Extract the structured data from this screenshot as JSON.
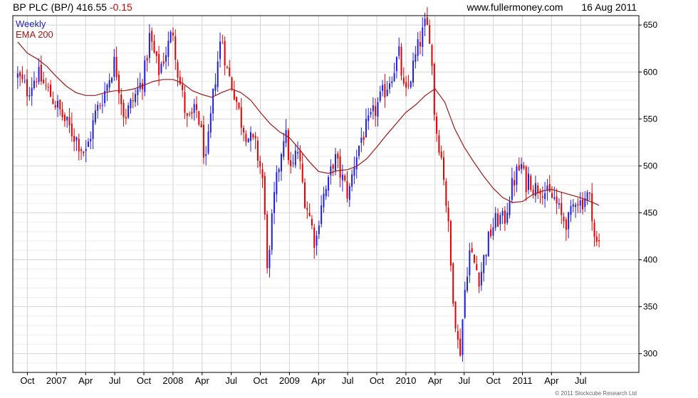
{
  "header": {
    "name": "BP PLC",
    "symbol": "(BP/)",
    "price": "416.55",
    "change": "-0.15",
    "site": "www.fullermoney.com",
    "date": "16 Aug 2011"
  },
  "footer": {
    "copyright": "© 2011 Stockcube Research Ltd"
  },
  "chart_data": {
    "type": "candlestick",
    "title": "BP PLC (BP/) 416.55 -0.15",
    "legend": [
      {
        "label": "Weekly",
        "color": "#1f1fbf"
      },
      {
        "label": "EMA 200",
        "color": "#a01818"
      }
    ],
    "legend_position": "top-left",
    "colors": {
      "up": "#1f1fe0",
      "down": "#e00000",
      "ema": "#a01818",
      "grid": "#d4d4d4"
    },
    "grid": true,
    "yaxis_side": "right",
    "ylim": [
      280,
      660
    ],
    "yticks": [
      300,
      350,
      400,
      450,
      500,
      550,
      600,
      650
    ],
    "xlim": [
      -1.5,
      63
    ],
    "xticks": [
      {
        "label": "Oct",
        "x": 0
      },
      {
        "label": "2007",
        "x": 3
      },
      {
        "label": "Apr",
        "x": 6
      },
      {
        "label": "Jul",
        "x": 9
      },
      {
        "label": "Oct",
        "x": 12
      },
      {
        "label": "2008",
        "x": 15
      },
      {
        "label": "Apr",
        "x": 18
      },
      {
        "label": "Jul",
        "x": 21
      },
      {
        "label": "Oct",
        "x": 24
      },
      {
        "label": "2009",
        "x": 27
      },
      {
        "label": "Apr",
        "x": 30
      },
      {
        "label": "Jul",
        "x": 33
      },
      {
        "label": "Oct",
        "x": 36
      },
      {
        "label": "2010",
        "x": 39
      },
      {
        "label": "Apr",
        "x": 42
      },
      {
        "label": "Jul",
        "x": 45
      },
      {
        "label": "Oct",
        "x": 48
      },
      {
        "label": "2011",
        "x": 51
      },
      {
        "label": "Apr",
        "x": 54
      },
      {
        "label": "Jul",
        "x": 57
      }
    ],
    "price_path": [
      [
        -1.0,
        595
      ],
      [
        0.0,
        580
      ],
      [
        1.0,
        598
      ],
      [
        2.0,
        582
      ],
      [
        3.0,
        565
      ],
      [
        4.0,
        545
      ],
      [
        5.0,
        530
      ],
      [
        6.0,
        512
      ],
      [
        7.0,
        555
      ],
      [
        8.0,
        580
      ],
      [
        9.0,
        612
      ],
      [
        10.0,
        552
      ],
      [
        11.0,
        572
      ],
      [
        12.0,
        595
      ],
      [
        12.6,
        638
      ],
      [
        13.5,
        600
      ],
      [
        14.5,
        628
      ],
      [
        15.0,
        645
      ],
      [
        15.5,
        600
      ],
      [
        16.5,
        545
      ],
      [
        17.5,
        560
      ],
      [
        18.4,
        502
      ],
      [
        19.3,
        590
      ],
      [
        20.0,
        640
      ],
      [
        20.6,
        600
      ],
      [
        21.3,
        580
      ],
      [
        22.0,
        548
      ],
      [
        22.8,
        530
      ],
      [
        23.5,
        520
      ],
      [
        24.2,
        490
      ],
      [
        24.8,
        382
      ],
      [
        25.3,
        455
      ],
      [
        25.9,
        500
      ],
      [
        26.5,
        540
      ],
      [
        27.2,
        490
      ],
      [
        27.8,
        520
      ],
      [
        28.5,
        470
      ],
      [
        29.2,
        440
      ],
      [
        29.7,
        415
      ],
      [
        30.2,
        460
      ],
      [
        31.0,
        480
      ],
      [
        31.6,
        510
      ],
      [
        32.3,
        490
      ],
      [
        33.1,
        468
      ],
      [
        33.7,
        505
      ],
      [
        34.4,
        530
      ],
      [
        35.2,
        545
      ],
      [
        36.1,
        565
      ],
      [
        36.8,
        580
      ],
      [
        37.6,
        600
      ],
      [
        38.3,
        618
      ],
      [
        38.9,
        570
      ],
      [
        39.6,
        600
      ],
      [
        40.3,
        628
      ],
      [
        41.0,
        650
      ],
      [
        41.5,
        640
      ],
      [
        42.0,
        545
      ],
      [
        42.5,
        520
      ],
      [
        42.9,
        490
      ],
      [
        43.4,
        430
      ],
      [
        43.7,
        380
      ],
      [
        44.0,
        350
      ],
      [
        44.3,
        312
      ],
      [
        44.6,
        305
      ],
      [
        45.0,
        360
      ],
      [
        45.5,
        410
      ],
      [
        46.1,
        395
      ],
      [
        46.6,
        380
      ],
      [
        47.2,
        410
      ],
      [
        47.9,
        435
      ],
      [
        48.6,
        445
      ],
      [
        49.1,
        440
      ],
      [
        49.7,
        470
      ],
      [
        50.3,
        490
      ],
      [
        50.9,
        500
      ],
      [
        51.3,
        480
      ],
      [
        51.7,
        490
      ],
      [
        52.2,
        475
      ],
      [
        52.9,
        480
      ],
      [
        53.6,
        468
      ],
      [
        54.3,
        465
      ],
      [
        55.0,
        445
      ],
      [
        55.8,
        440
      ],
      [
        56.5,
        468
      ],
      [
        57.0,
        460
      ],
      [
        57.6,
        470
      ],
      [
        58.1,
        460
      ],
      [
        58.5,
        415
      ],
      [
        58.9,
        416.55
      ]
    ],
    "ema_200": [
      [
        -1.0,
        632
      ],
      [
        0.0,
        620
      ],
      [
        1.0,
        614
      ],
      [
        2.0,
        606
      ],
      [
        3.0,
        595
      ],
      [
        4.0,
        585
      ],
      [
        5.0,
        578
      ],
      [
        6.0,
        575
      ],
      [
        7.0,
        575
      ],
      [
        8.0,
        578
      ],
      [
        9.0,
        580
      ],
      [
        10.0,
        580
      ],
      [
        11.0,
        582
      ],
      [
        12.0,
        586
      ],
      [
        13.0,
        590
      ],
      [
        14.0,
        592
      ],
      [
        15.0,
        592
      ],
      [
        16.0,
        588
      ],
      [
        17.0,
        580
      ],
      [
        18.0,
        576
      ],
      [
        19.0,
        573
      ],
      [
        20.0,
        578
      ],
      [
        21.0,
        582
      ],
      [
        22.0,
        578
      ],
      [
        23.0,
        570
      ],
      [
        24.0,
        557
      ],
      [
        25.0,
        545
      ],
      [
        26.0,
        536
      ],
      [
        27.0,
        530
      ],
      [
        28.0,
        518
      ],
      [
        29.0,
        505
      ],
      [
        30.0,
        494
      ],
      [
        31.0,
        492
      ],
      [
        32.0,
        495
      ],
      [
        33.0,
        496
      ],
      [
        34.0,
        500
      ],
      [
        35.0,
        508
      ],
      [
        36.0,
        520
      ],
      [
        37.0,
        533
      ],
      [
        38.0,
        545
      ],
      [
        39.0,
        557
      ],
      [
        40.0,
        565
      ],
      [
        41.0,
        575
      ],
      [
        42.0,
        582
      ],
      [
        43.0,
        568
      ],
      [
        44.0,
        540
      ],
      [
        45.0,
        520
      ],
      [
        46.0,
        504
      ],
      [
        47.0,
        489
      ],
      [
        48.0,
        476
      ],
      [
        49.0,
        466
      ],
      [
        50.0,
        461
      ],
      [
        51.0,
        462
      ],
      [
        52.0,
        469
      ],
      [
        53.0,
        473
      ],
      [
        54.0,
        475
      ],
      [
        55.0,
        472
      ],
      [
        56.0,
        469
      ],
      [
        57.0,
        466
      ],
      [
        58.0,
        462
      ],
      [
        58.9,
        458
      ]
    ]
  }
}
